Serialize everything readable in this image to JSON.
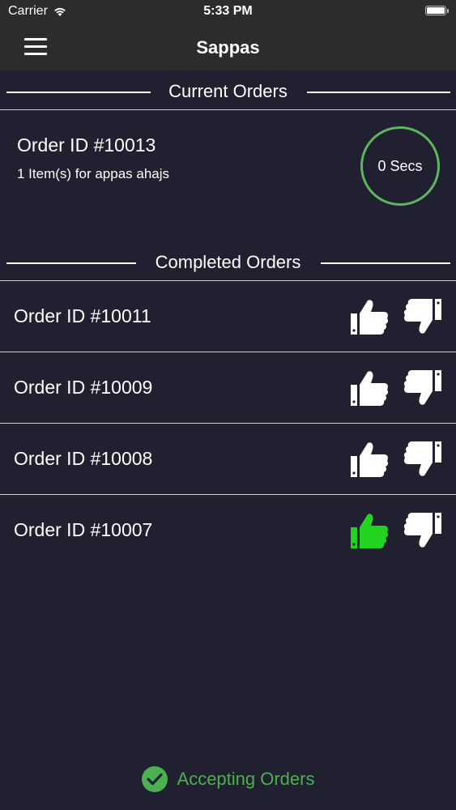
{
  "status_bar": {
    "carrier": "Carrier",
    "time": "5:33 PM"
  },
  "nav": {
    "title": "Sappas",
    "menu_icon": "hamburger-icon"
  },
  "current_section": {
    "title": "Current Orders"
  },
  "current_order": {
    "order_id": "Order ID #10013",
    "summary": "1 Item(s) for appas ahajs",
    "timer": "0 Secs",
    "timer_color": "#5fb55f"
  },
  "completed_section": {
    "title": "Completed Orders"
  },
  "completed_orders": [
    {
      "order_id": "Order ID #10011",
      "thumbs_up_active": false
    },
    {
      "order_id": "Order ID #10009",
      "thumbs_up_active": false
    },
    {
      "order_id": "Order ID #10008",
      "thumbs_up_active": false
    },
    {
      "order_id": "Order ID #10007",
      "thumbs_up_active": true
    }
  ],
  "colors": {
    "active_thumb": "#22d322",
    "inactive_thumb": "#ffffff",
    "accent": "#4caf50",
    "background": "#212030"
  },
  "footer": {
    "status": "Accepting Orders",
    "icon": "check-circle-icon"
  }
}
